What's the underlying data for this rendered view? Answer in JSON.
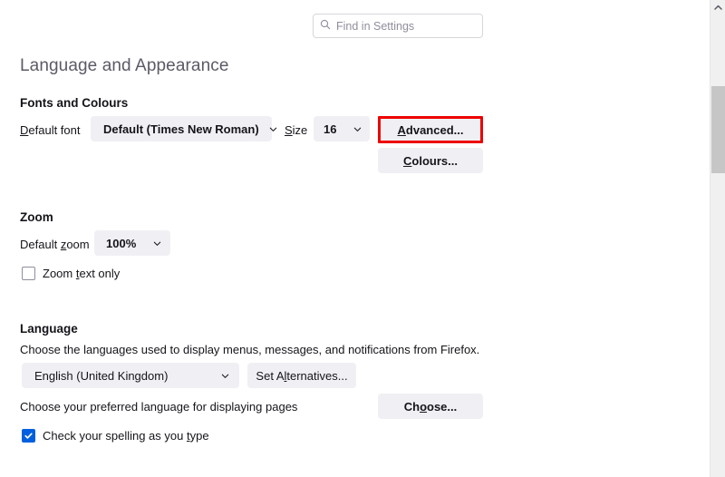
{
  "search": {
    "placeholder": "Find in Settings",
    "value": "",
    "icon": "search-icon"
  },
  "page": {
    "title": "Language and Appearance"
  },
  "sections": {
    "fonts": {
      "heading": "Fonts and Colours",
      "default_font_label_pre": "D",
      "default_font_label_post": "efault font",
      "default_font_value": "Default (Times New Roman)",
      "size_label_pre": "S",
      "size_label_post": "ize",
      "size_value": "16",
      "advanced_button_pre": "A",
      "advanced_button_post": "dvanced...",
      "colours_button_pre": "C",
      "colours_button_post": "olours...",
      "highlight_colour": "#ee0000"
    },
    "zoom": {
      "heading": "Zoom",
      "default_zoom_label_pre": "Default ",
      "default_zoom_label_key": "z",
      "default_zoom_label_post": "oom",
      "default_zoom_value": "100%",
      "zoom_text_only_pre": "Zoom ",
      "zoom_text_only_key": "t",
      "zoom_text_only_post": "ext only",
      "zoom_text_only_checked": "false"
    },
    "language": {
      "heading": "Language",
      "description": "Choose the languages used to display menus, messages, and notifications from Firefox.",
      "language_value": "English (United Kingdom)",
      "set_alternatives_pre": "Set A",
      "set_alternatives_key": "l",
      "set_alternatives_post": "ternatives...",
      "pages_description": "Choose your preferred language for displaying pages",
      "choose_button_pre": "Ch",
      "choose_button_key": "o",
      "choose_button_post": "ose...",
      "spellcheck_pre": "Check your spelling as you ",
      "spellcheck_key": "t",
      "spellcheck_post": "ype",
      "spellcheck_checked": "true"
    }
  },
  "scrollbar": {
    "up_arrow": "chevron-up-icon",
    "thumb_position": "95",
    "thumb_height": "96"
  }
}
